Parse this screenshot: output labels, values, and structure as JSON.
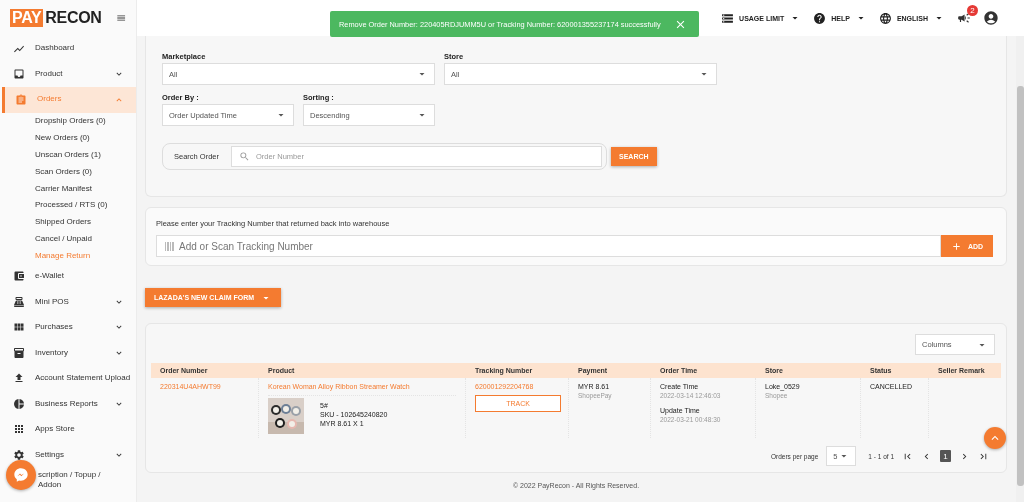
{
  "brand": {
    "part_1": "PAY",
    "part_2": "RECON"
  },
  "toast": {
    "message": "Remove Order Number: 220405RDJUMM5U or Tracking Number: 620001355237174 successfully"
  },
  "header": {
    "menus": [
      {
        "label": "USAGE LIMIT"
      },
      {
        "label": "HELP"
      },
      {
        "label": "ENGLISH"
      }
    ],
    "notification_count": "2"
  },
  "sidebar": {
    "items": [
      {
        "label": "Dashboard",
        "kind": "link",
        "selected": false
      },
      {
        "label": "Product",
        "kind": "group",
        "selected": false,
        "expanded": false
      },
      {
        "label": "Orders",
        "kind": "group",
        "selected": true,
        "expanded": true,
        "children": [
          {
            "label": "Dropship Orders (0)",
            "selected": false
          },
          {
            "label": "New Orders (0)",
            "selected": false
          },
          {
            "label": "Unscan Orders (1)",
            "selected": false
          },
          {
            "label": "Scan Orders (0)",
            "selected": false
          },
          {
            "label": "Carrier Manifest",
            "selected": false
          },
          {
            "label": "Processed / RTS (0)",
            "selected": false
          },
          {
            "label": "Shipped Orders",
            "selected": false
          },
          {
            "label": "Cancel / Unpaid",
            "selected": false
          },
          {
            "label": "Manage Return",
            "selected": true
          }
        ]
      },
      {
        "label": "e-Wallet",
        "kind": "link",
        "selected": false
      },
      {
        "label": "Mini POS",
        "kind": "group",
        "selected": false,
        "expanded": false
      },
      {
        "label": "Purchases",
        "kind": "group",
        "selected": false,
        "expanded": false
      },
      {
        "label": "Inventory",
        "kind": "group",
        "selected": false,
        "expanded": false
      },
      {
        "label": "Account Statement Upload",
        "kind": "link",
        "selected": false
      },
      {
        "label": "Business Reports",
        "kind": "group",
        "selected": false,
        "expanded": false
      },
      {
        "label": "Apps Store",
        "kind": "link",
        "selected": false
      },
      {
        "label": "Settings",
        "kind": "group",
        "selected": false,
        "expanded": false
      },
      {
        "label": "scription / Topup / Addon",
        "kind": "link",
        "selected": false
      }
    ]
  },
  "filters": {
    "marketplace": {
      "label": "Marketplace",
      "value": "All"
    },
    "store": {
      "label": "Store",
      "value": "All"
    },
    "order_by": {
      "label": "Order By :",
      "value": "Order Updated Time"
    },
    "sorting": {
      "label": "Sorting :",
      "value": "Descending"
    },
    "search": {
      "label": "Search Order",
      "placeholder": "Order Number",
      "button": "SEARCH"
    }
  },
  "tracking": {
    "instruction": "Please enter your Tracking Number that returned back into warehouse",
    "placeholder": "Add or Scan Tracking Number",
    "button": "ADD"
  },
  "claim_button": "LAZADA'S NEW CLAIM FORM",
  "table": {
    "columns_select": "Columns",
    "columns": [
      "Order Number",
      "Product",
      "Tracking Number",
      "Payment",
      "Order Time",
      "Store",
      "Status",
      "Seller Remark"
    ],
    "rows": [
      {
        "order_number": "220314U4AHWT99",
        "product": {
          "title": "Korean Woman Alloy Ribbon Streamer Watch",
          "variant": "5#",
          "sku": "SKU - 102645240820",
          "price": "MYR 8.61 X 1"
        },
        "tracking_number": "620001292204768",
        "track_button": "TRACK",
        "payment": {
          "amount": "MYR 8.61",
          "method": "ShopeePay"
        },
        "order_time": {
          "create_label": "Create Time",
          "create_value": "2022-03-14 12:46:03",
          "update_label": "Update Time",
          "update_value": "2022-03-21 00:48:30"
        },
        "store": {
          "name": "Loke_0529",
          "marketplace": "Shopee"
        },
        "status": "CANCELLED"
      }
    ]
  },
  "pagination": {
    "label": "Orders per page",
    "per_page": "5",
    "range": "1 - 1 of 1",
    "pages": [
      {
        "label": "1",
        "selected": true
      }
    ]
  },
  "footer": "© 2022 PayRecon - All Rights Reserved."
}
